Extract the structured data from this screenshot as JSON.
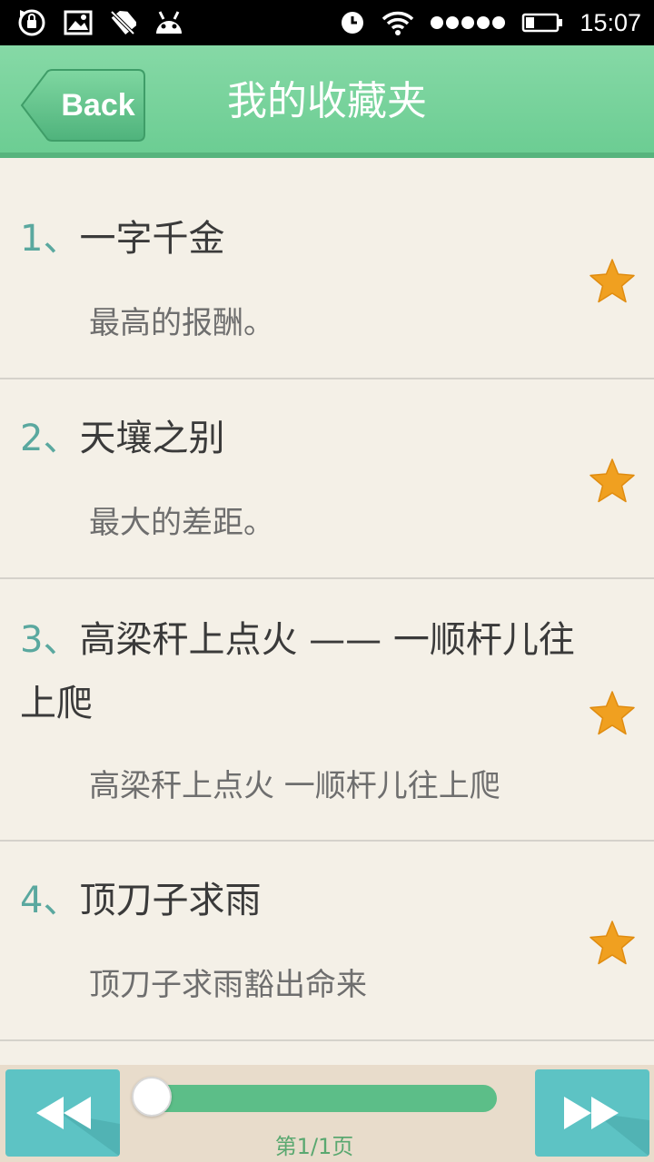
{
  "status_bar": {
    "time": "15:07",
    "icons_left": [
      "sync-lock-icon",
      "image-icon",
      "no-sim-icon",
      "android-icon"
    ],
    "icons_right": [
      "alarm-clock-icon",
      "wifi-icon",
      "signal-dots-icon",
      "battery-icon"
    ]
  },
  "header": {
    "back_label": "Back",
    "title": "我的收藏夹",
    "color": "#76d39b"
  },
  "items": [
    {
      "num": "1、",
      "title": "一字千金",
      "desc": "最高的报酬。",
      "starred": true
    },
    {
      "num": "2、",
      "title": "天壤之别",
      "desc": "最大的差距。",
      "starred": true
    },
    {
      "num": "3、",
      "title": "高梁秆上点火 —— 一顺杆儿往上爬",
      "desc": "高梁秆上点火 一顺杆儿往上爬",
      "starred": true
    },
    {
      "num": "4、",
      "title": "顶刀子求雨",
      "desc": "顶刀子求雨豁出命来",
      "starred": true
    }
  ],
  "bottom_bar": {
    "page_label": "第1/1页",
    "progress": 0.0,
    "prev_icon": "rewind-icon",
    "next_icon": "fast-forward-icon"
  },
  "colors": {
    "accent_green": "#76d39b",
    "teal": "#5dc3c4",
    "star": "#f0a020",
    "background": "#f4f0e7"
  }
}
